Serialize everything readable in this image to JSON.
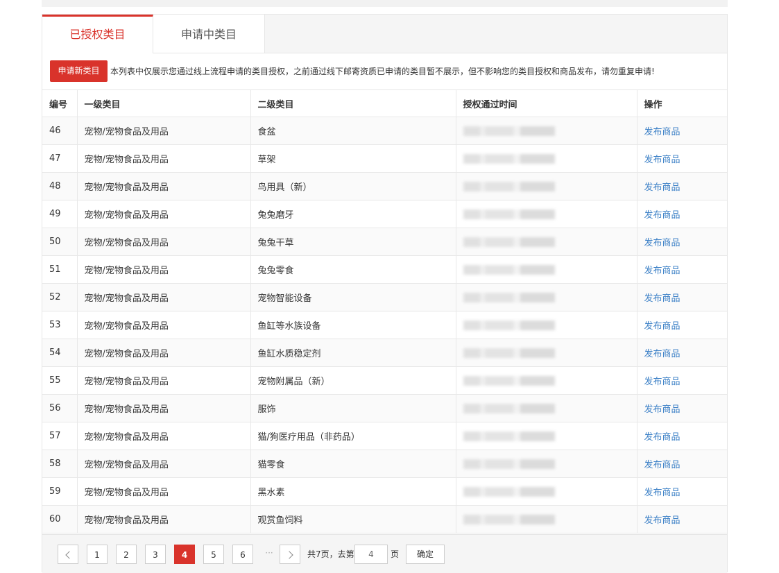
{
  "tabs": [
    {
      "label": "已授权类目"
    },
    {
      "label": "申请中类目"
    }
  ],
  "notice": {
    "button_label": "申请新类目",
    "text": "本列表中仅展示您通过线上流程申请的类目授权，之前通过线下邮寄资质已申请的类目暂不展示，但不影响您的类目授权和商品发布，请勿重复申请!"
  },
  "table": {
    "headers": [
      "编号",
      "一级类目",
      "二级类目",
      "授权通过时间",
      "操作"
    ],
    "rows": [
      {
        "id": "46",
        "level1": "宠物/宠物食品及用品",
        "level2": "食盆",
        "action": "发布商品"
      },
      {
        "id": "47",
        "level1": "宠物/宠物食品及用品",
        "level2": "草架",
        "action": "发布商品"
      },
      {
        "id": "48",
        "level1": "宠物/宠物食品及用品",
        "level2": "鸟用具（新）",
        "action": "发布商品"
      },
      {
        "id": "49",
        "level1": "宠物/宠物食品及用品",
        "level2": "兔兔磨牙",
        "action": "发布商品"
      },
      {
        "id": "50",
        "level1": "宠物/宠物食品及用品",
        "level2": "兔兔干草",
        "action": "发布商品"
      },
      {
        "id": "51",
        "level1": "宠物/宠物食品及用品",
        "level2": "兔兔零食",
        "action": "发布商品"
      },
      {
        "id": "52",
        "level1": "宠物/宠物食品及用品",
        "level2": "宠物智能设备",
        "action": "发布商品"
      },
      {
        "id": "53",
        "level1": "宠物/宠物食品及用品",
        "level2": "鱼缸等水族设备",
        "action": "发布商品"
      },
      {
        "id": "54",
        "level1": "宠物/宠物食品及用品",
        "level2": "鱼缸水质稳定剂",
        "action": "发布商品"
      },
      {
        "id": "55",
        "level1": "宠物/宠物食品及用品",
        "level2": "宠物附属品（新）",
        "action": "发布商品"
      },
      {
        "id": "56",
        "level1": "宠物/宠物食品及用品",
        "level2": "服饰",
        "action": "发布商品"
      },
      {
        "id": "57",
        "level1": "宠物/宠物食品及用品",
        "level2": "猫/狗医疗用品（非药品）",
        "action": "发布商品"
      },
      {
        "id": "58",
        "level1": "宠物/宠物食品及用品",
        "level2": "猫零食",
        "action": "发布商品"
      },
      {
        "id": "59",
        "level1": "宠物/宠物食品及用品",
        "level2": "黑水素",
        "action": "发布商品"
      },
      {
        "id": "60",
        "level1": "宠物/宠物食品及用品",
        "level2": "观赏鱼饲料",
        "action": "发布商品"
      }
    ]
  },
  "pager": {
    "pages": [
      "1",
      "2",
      "3",
      "4",
      "5",
      "6"
    ],
    "current": "4",
    "ellipsis": "···",
    "total_text": "共7页，去第",
    "page_suffix": "页",
    "input_value": "4",
    "confirm_label": "确定"
  }
}
